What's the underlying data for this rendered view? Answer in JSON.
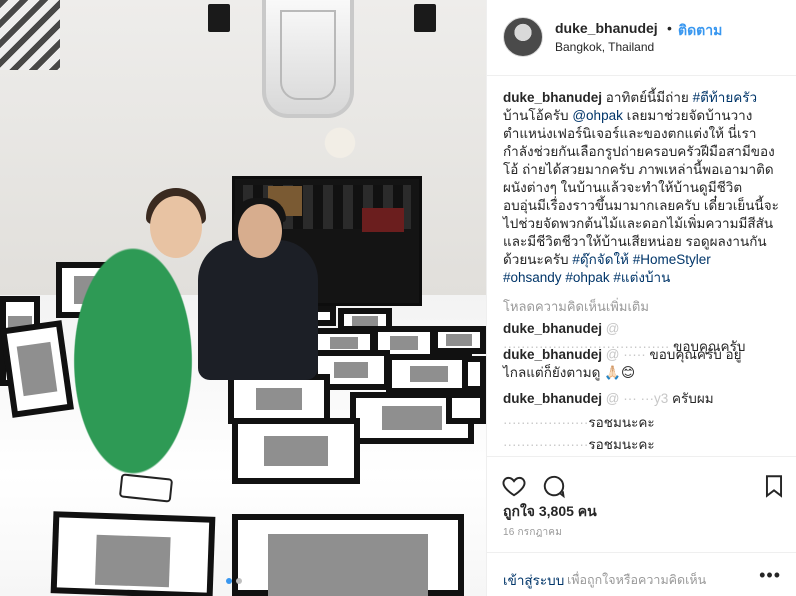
{
  "post": {
    "username": "duke_bhanudej",
    "separator": "•",
    "follow_label": "ติดตาม",
    "location": "Bangkok, Thailand",
    "caption_user": "duke_bhanudej",
    "caption_lines": [
      [
        "อาทิตย์นี้มีถ่าย ",
        "#ตีท้ายครัว"
      ],
      [
        "บ้านโอ้ครับ ",
        "@ohpak",
        " เลยมาช่วยจัดบ้านวาง"
      ],
      [
        "ตำแหน่งเฟอร์นิเจอร์และของตกแต่งให้ นี่เรา"
      ],
      [
        "กำลังช่วยกันเลือกรูปถ่ายครอบครัวฝีมือสามีของ"
      ],
      [
        "โอ้ ถ่ายได้สวยมากครับ ภาพเหล่านี้พอเอามาติด"
      ],
      [
        "ผนังต่างๆ ในบ้านแล้วจะทำให้บ้านดูมีชีวิต"
      ],
      [
        "อบอุ่นมีเรื่องราวขึ้นมามากเลยครับ เดี๋ยวเย็นนี้จะ"
      ],
      [
        "ไปช่วยจัดพวกต้นไม้และดอกไม้เพิ่มความมีสีสัน"
      ],
      [
        "และมีชีวิตชีวาให้บ้านเสียหน่อย รอดูผลงานกัน"
      ],
      [
        "ด้วยนะครับ ",
        "#ดุ๊กจัดให้",
        " ",
        "#HomeStyler"
      ],
      [
        "#ohsandy",
        " ",
        "#ohpak",
        " ",
        "#แต่งบ้าน"
      ]
    ],
    "load_more": "โหลดความคิดเห็นเพิ่มเติม",
    "comments": [
      {
        "user": "duke_bhanudej",
        "mention": "@ ·····································",
        "text": " ขอบคุณครับ"
      },
      {
        "user": "duke_bhanudej",
        "mention": "@ ·····",
        "text": " ขอบคุณครับ อยู่",
        "text2": "ไกลแต่ก็ยังตามดู 🙏🏻😊"
      },
      {
        "user": "duke_bhanudej",
        "mention": "@ ··· ···y3",
        "text": " ครับผม"
      },
      {
        "user": "",
        "mention": "···················",
        "text": "รอชมนะคะ"
      },
      {
        "user": "",
        "mention": "···················",
        "text": "รอชมนะคะ"
      }
    ],
    "likes": "ถูกใจ 3,805 คน",
    "date": "16 กรกฎาคม",
    "login_label": "เข้าสู่ระบบ",
    "login_hint": "เพื่อถูกใจหรือความคิดเห็น",
    "more_options": "•••"
  },
  "colors": {
    "link": "#3897f0",
    "tag": "#003569",
    "muted": "#999999",
    "text": "#262626",
    "border": "#efefef"
  },
  "icons": {
    "like": "heart-icon",
    "comment": "comment-bubble-icon",
    "save": "bookmark-icon",
    "more": "more-dots-icon"
  },
  "carousel": {
    "count": 2,
    "active": 1
  }
}
